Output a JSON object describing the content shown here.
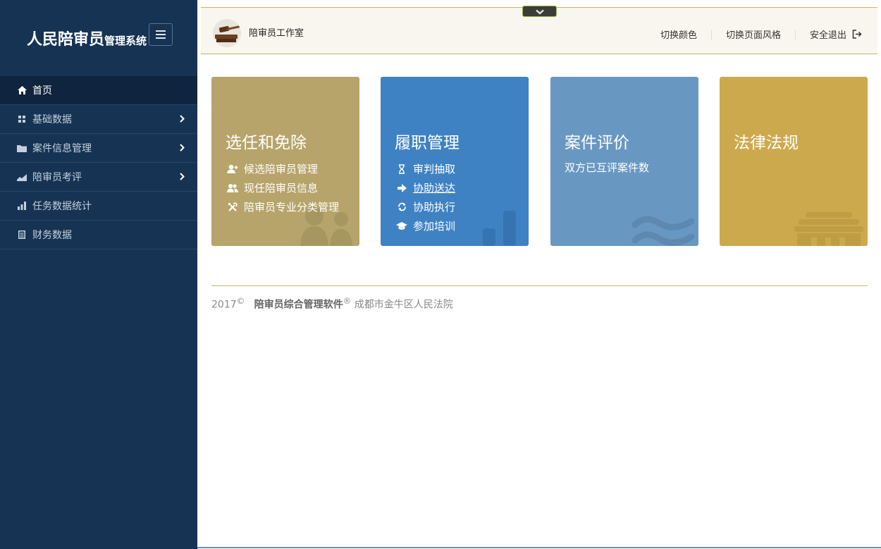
{
  "sidebar": {
    "brand_main": "人民陪审员",
    "brand_small": "管理系统",
    "items": [
      {
        "label": "首页"
      },
      {
        "label": "基础数据"
      },
      {
        "label": "案件信息管理"
      },
      {
        "label": "陪审员考评"
      },
      {
        "label": "任务数据统计"
      },
      {
        "label": "财务数据"
      }
    ]
  },
  "topbar": {
    "studio": "陪审员工作室",
    "switch_color": "切换颜色",
    "switch_style": "切换页面风格",
    "logout": "安全退出"
  },
  "cards": [
    {
      "title": "选任和免除",
      "color": "#b6a46a",
      "items": [
        "候选陪审员管理",
        "现任陪审员信息",
        "陪审员专业分类管理"
      ]
    },
    {
      "title": "履职管理",
      "color": "#3e82c3",
      "items": [
        "审判抽取",
        "协助送达",
        "协助执行",
        "参加培训"
      ]
    },
    {
      "title": "案件评价",
      "color": "#6898c2",
      "subtitle": "双方已互评案件数"
    },
    {
      "title": "法律法规",
      "color": "#cca94c"
    }
  ],
  "footer": {
    "year": "2017",
    "copyright_mark": "©",
    "product": "陪审员综合管理软件",
    "registered_mark": "®",
    "org": "成都市金牛区人民法院"
  }
}
